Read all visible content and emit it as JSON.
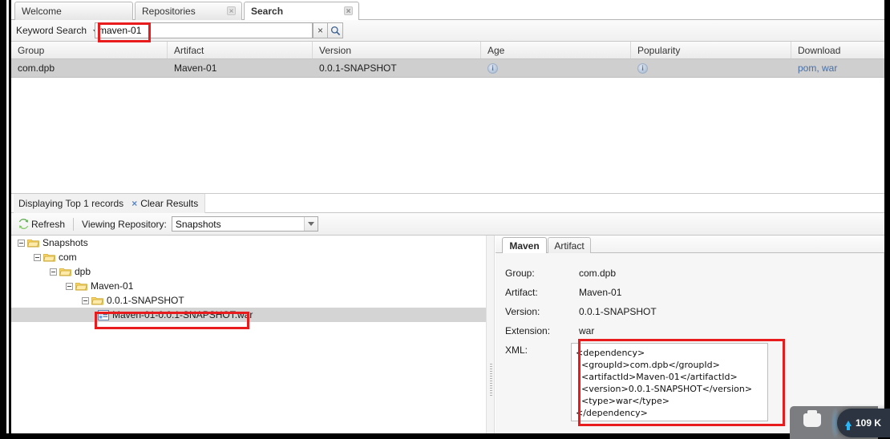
{
  "window": {
    "tabs": [
      {
        "label": "Welcome",
        "close": "×",
        "active": false
      },
      {
        "label": "Repositories",
        "close": "×",
        "active": false
      },
      {
        "label": "Search",
        "close": "×",
        "active": true
      }
    ]
  },
  "search": {
    "label": "Keyword Search",
    "caret_icon": "chevron-down-icon",
    "value": "maven-01",
    "placeholder": "",
    "clear_label": "×",
    "go_icon": "magnifier-icon"
  },
  "results": {
    "columns": [
      "Group",
      "Artifact",
      "Version",
      "Age",
      "Popularity",
      "Download"
    ],
    "rows": [
      {
        "group": "com.dpb",
        "artifact": "Maven-01",
        "version": "0.0.1-SNAPSHOT",
        "age_icon": "info-icon",
        "age": "i",
        "popularity_icon": "info-icon",
        "popularity": "i",
        "download": "pom, war"
      }
    ],
    "status": "Displaying Top 1 records",
    "clear_x": "×",
    "clear_label": "Clear Results"
  },
  "repo_toolbar": {
    "refresh_label": "Refresh",
    "refresh_icon": "refresh-icon",
    "viewing_label": "Viewing Repository:",
    "selected_repository": "Snapshots",
    "repository_options": [
      "Snapshots"
    ],
    "dropdown_icon": "chevron-down-icon"
  },
  "tree": {
    "nodes": [
      {
        "label": "Snapshots",
        "indent": 8,
        "icon": "folder-icon",
        "expanded": true,
        "selected": false
      },
      {
        "label": "com",
        "indent": 28,
        "icon": "folder-icon",
        "expanded": true,
        "selected": false
      },
      {
        "label": "dpb",
        "indent": 48,
        "icon": "folder-icon",
        "expanded": true,
        "selected": false
      },
      {
        "label": "Maven-01",
        "indent": 68,
        "icon": "folder-icon",
        "expanded": true,
        "selected": false
      },
      {
        "label": "0.0.1-SNAPSHOT",
        "indent": 88,
        "icon": "folder-icon",
        "expanded": true,
        "selected": false
      },
      {
        "label": "Maven-01-0.0.1-SNAPSHOT.war",
        "indent": 108,
        "icon": "file-icon",
        "expanded": false,
        "selected": true
      }
    ]
  },
  "detail": {
    "tabs": [
      {
        "label": "Maven",
        "active": true
      },
      {
        "label": "Artifact",
        "active": false
      }
    ],
    "fields": [
      {
        "label": "Group:",
        "value": "com.dpb"
      },
      {
        "label": "Artifact:",
        "value": "Maven-01"
      },
      {
        "label": "Version:",
        "value": "0.0.1-SNAPSHOT"
      },
      {
        "label": "Extension:",
        "value": "war"
      },
      {
        "label": "XML:",
        "value": ""
      }
    ],
    "xml": "<dependency>\n  <groupId>com.dpb</groupId>\n  <artifactId>Maven-01</artifactId>\n  <version>0.0.1-SNAPSHOT</version>\n  <type>war</type>\n</dependency>"
  },
  "overlay": {
    "upload_icon": "upload-arrow-icon",
    "rate": "109 K",
    "usb_icon": "usb-drive-icon"
  },
  "colors": {
    "annotation": "#e81c1c",
    "link": "#4a6ea0",
    "selection": "#d4d4d4",
    "row": "#cfcfcf",
    "accent": "#29b6f6"
  }
}
